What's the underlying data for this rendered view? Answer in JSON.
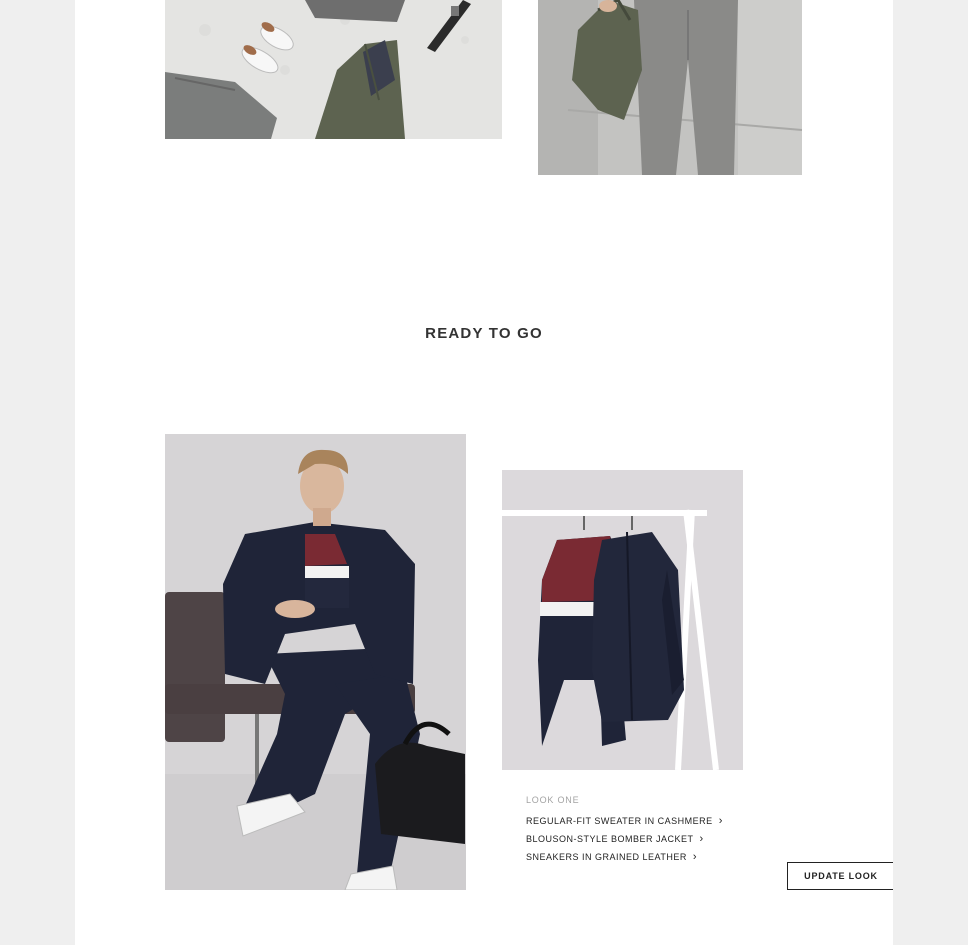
{
  "section": {
    "title": "READY TO GO"
  },
  "look": {
    "label": "LOOK ONE",
    "items": [
      {
        "label": "REGULAR-FIT SWEATER IN CASHMERE",
        "icon": "chevron-right-icon"
      },
      {
        "label": "BLOUSON-STYLE BOMBER JACKET",
        "icon": "chevron-right-icon"
      },
      {
        "label": "SNEAKERS IN GRAINED LEATHER",
        "icon": "chevron-right-icon"
      }
    ]
  },
  "actions": {
    "update_look": "UPDATE LOOK"
  },
  "colors": {
    "page_bg": "#efefef",
    "content_bg": "#ffffff",
    "text_dark": "#222222",
    "muted_label": "#a3a3a3",
    "navy": "#1f2438",
    "burgundy": "#7a2a33",
    "olive": "#5d6350"
  }
}
